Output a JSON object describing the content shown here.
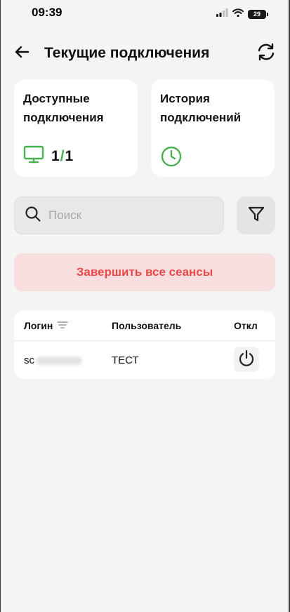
{
  "status_bar": {
    "time": "09:39",
    "battery": "29"
  },
  "header": {
    "title": "Текущие подключения"
  },
  "cards": {
    "available": {
      "title": "Доступные подключения",
      "active": "1",
      "separator": "/",
      "total": "1"
    },
    "history": {
      "title": "История подключений"
    }
  },
  "search": {
    "placeholder": "Поиск",
    "value": ""
  },
  "actions": {
    "end_all_label": "Завершить все сеансы"
  },
  "table": {
    "columns": {
      "login": "Логин",
      "user": "Пользователь",
      "disconnect": "Откл"
    },
    "rows": [
      {
        "login_visible": "sc",
        "user": "ТЕСТ"
      }
    ]
  },
  "colors": {
    "accent_green": "#4caf50",
    "danger_red": "#e84a4a",
    "danger_bg": "#f8dede"
  },
  "icons": [
    "back-arrow-icon",
    "refresh-icon",
    "monitor-icon",
    "clock-icon",
    "search-icon",
    "filter-icon",
    "sort-icon",
    "power-icon"
  ]
}
